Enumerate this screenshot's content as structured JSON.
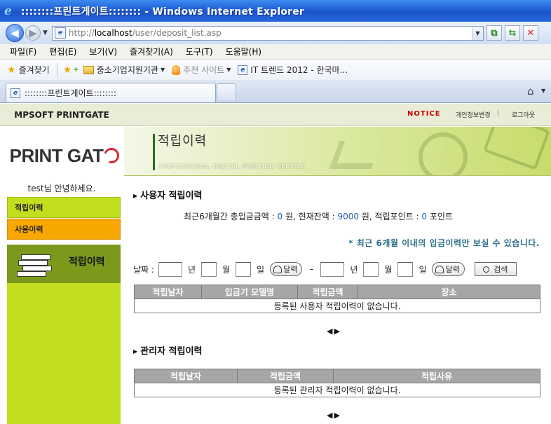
{
  "window": {
    "title": "::::::::프린트게이트:::::::: - Windows Internet Explorer"
  },
  "address": {
    "url_prefix": "http://",
    "url_host": "localhost",
    "url_path": "/user/deposit_list.asp"
  },
  "menubar": {
    "items": [
      "파일(F)",
      "편집(E)",
      "보기(V)",
      "즐겨찾기(A)",
      "도구(T)",
      "도움말(H)"
    ]
  },
  "favorites": {
    "label": "즐겨찾기",
    "items": [
      "중소기업지원기관",
      "추천 사이트",
      "IT 트렌드 2012 - 한국마..."
    ]
  },
  "tab": {
    "label": "::::::::프린트게이트::::::::"
  },
  "site": {
    "brand": "MPSOFT PRINTGATE",
    "notice": "NOTICE",
    "profile_link": "개인정보변경",
    "separator": "|",
    "logout_link": "로그아웃",
    "logo_text_1": "PRINT GAT",
    "logo_text_2": "E"
  },
  "banner": {
    "title": "적립이력",
    "subtitle": "PROFESSIONAL DIGITAL PRINTING SERVICE"
  },
  "sidebar": {
    "greeting": "test님 안녕하세요.",
    "menu_deposit": "적립이력",
    "menu_usage": "사용이력",
    "panel_title": "적립이력"
  },
  "main": {
    "user_section_title": "사용자 적립이력",
    "summary": {
      "prefix": "최근6개월간 총입금금액 : ",
      "total_deposit": "0",
      "mid1": " 원, 현재잔액 : ",
      "balance": "9000",
      "mid2": " 원, 적립포인트 : ",
      "points": "0",
      "suffix": " 포인트"
    },
    "note": "* 최근 6개월 이내의 입금이력만 보실 수 있습니다.",
    "filter": {
      "date_label": "날짜 :",
      "year": "년",
      "month": "월",
      "day": "일",
      "calendar": "달력",
      "dash": "–",
      "search": "검색"
    },
    "user_table": {
      "headers": [
        "적립날자",
        "입금기 모델명",
        "적립금액",
        "장소"
      ],
      "empty": "등록된 사용자 적립이력이 없습니다."
    },
    "admin_section_title": "관리자 적립이력",
    "admin_table": {
      "headers": [
        "적립날자",
        "적립금액",
        "적립사유"
      ],
      "empty": "등록된 관리자 적립이력이 없습니다."
    },
    "pager": {
      "prev": "◀",
      "next": "▶"
    }
  }
}
